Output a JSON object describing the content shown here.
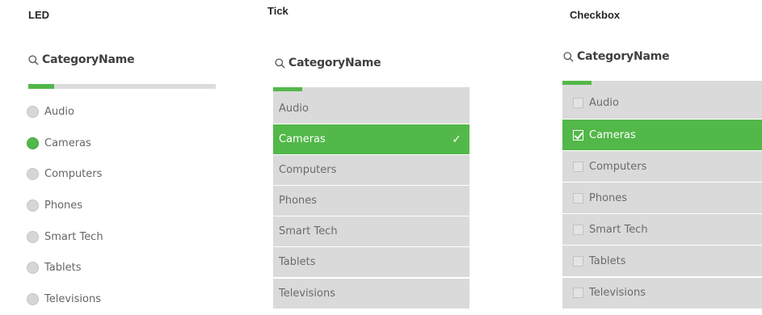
{
  "panels": {
    "led": {
      "title": "LED",
      "field": "CategoryName",
      "progress": 0.14,
      "items": [
        {
          "label": "Audio",
          "selected": false
        },
        {
          "label": "Cameras",
          "selected": true
        },
        {
          "label": "Computers",
          "selected": false
        },
        {
          "label": "Phones",
          "selected": false
        },
        {
          "label": "Smart Tech",
          "selected": false
        },
        {
          "label": "Tablets",
          "selected": false
        },
        {
          "label": "Televisions",
          "selected": false
        }
      ]
    },
    "tick": {
      "title": "Tick",
      "field": "CategoryName",
      "check_glyph": "✓",
      "items": [
        {
          "label": "Audio",
          "selected": false
        },
        {
          "label": "Cameras",
          "selected": true
        },
        {
          "label": "Computers",
          "selected": false
        },
        {
          "label": "Phones",
          "selected": false
        },
        {
          "label": "Smart Tech",
          "selected": false
        },
        {
          "label": "Tablets",
          "selected": false
        },
        {
          "label": "Televisions",
          "selected": false
        }
      ]
    },
    "checkbox": {
      "title": "Checkbox",
      "field": "CategoryName",
      "items": [
        {
          "label": "Audio",
          "selected": false
        },
        {
          "label": "Cameras",
          "selected": true
        },
        {
          "label": "Computers",
          "selected": false
        },
        {
          "label": "Phones",
          "selected": false
        },
        {
          "label": "Smart Tech",
          "selected": false
        },
        {
          "label": "Tablets",
          "selected": false
        },
        {
          "label": "Televisions",
          "selected": false
        }
      ]
    }
  },
  "colors": {
    "accent": "#52b849",
    "row_background": "#dadada",
    "text": "#595959"
  }
}
